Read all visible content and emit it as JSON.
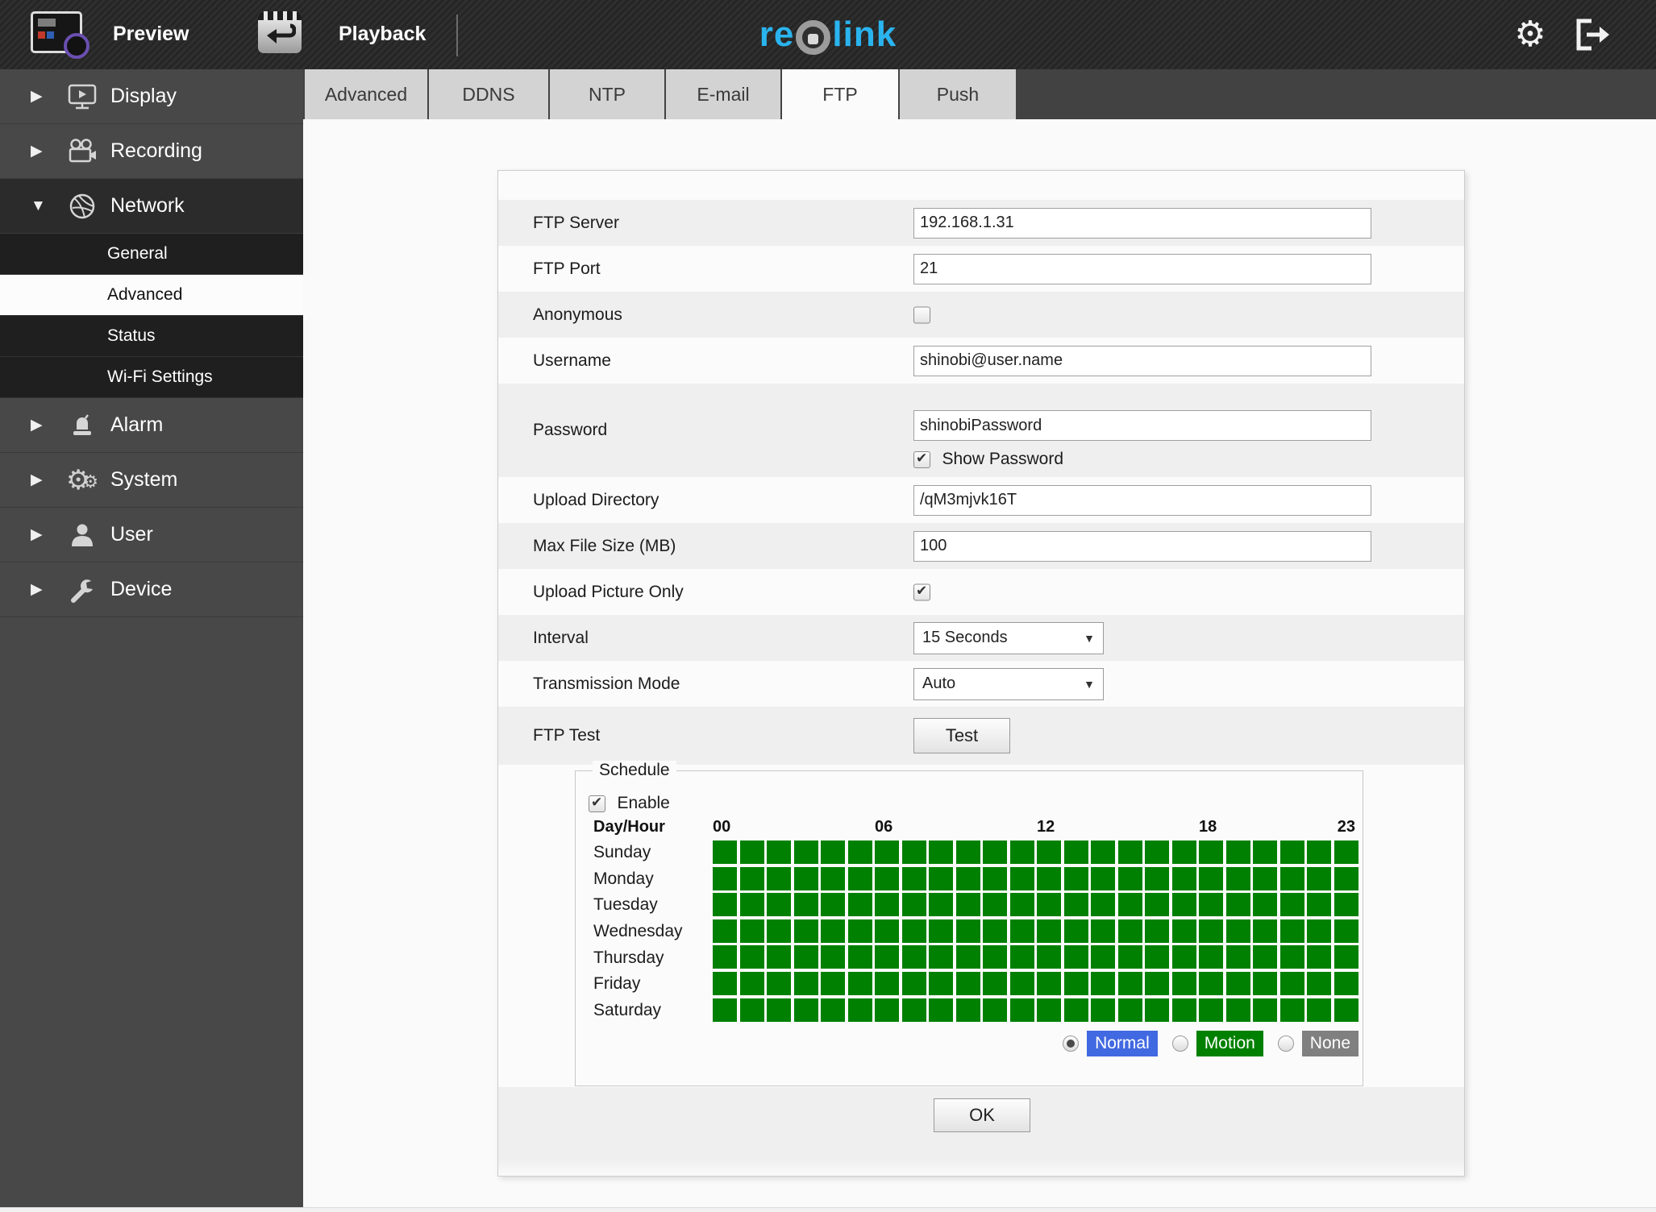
{
  "header": {
    "preview": "Preview",
    "playback": "Playback",
    "logo_part1": "re",
    "logo_part2": "link"
  },
  "glyphs": {
    "collapsed": "▶",
    "expanded": "▼",
    "dropdown": "▼",
    "gear": "⚙",
    "check": "✔"
  },
  "sidebar": {
    "display": "Display",
    "recording": "Recording",
    "network": "Network",
    "general": "General",
    "advanced": "Advanced",
    "status": "Status",
    "wifi": "Wi-Fi Settings",
    "alarm": "Alarm",
    "system": "System",
    "user": "User",
    "device": "Device"
  },
  "tabs": {
    "advanced": "Advanced",
    "ddns": "DDNS",
    "ntp": "NTP",
    "email": "E-mail",
    "ftp": "FTP",
    "push": "Push",
    "active_tab": "FTP"
  },
  "form": {
    "ftp_server": {
      "label": "FTP Server",
      "value": "192.168.1.31"
    },
    "ftp_port": {
      "label": "FTP Port",
      "value": "21"
    },
    "anonymous": {
      "label": "Anonymous",
      "checked": false,
      "glyph": ""
    },
    "username": {
      "label": "Username",
      "value": "shinobi@user.name"
    },
    "password": {
      "label": "Password",
      "value": "shinobiPassword",
      "show_password_label": "Show Password",
      "show_password_glyph": "✔"
    },
    "upload_directory": {
      "label": "Upload Directory",
      "value": "/qM3mjvk16T"
    },
    "max_file_size": {
      "label": "Max File Size (MB)",
      "value": "100"
    },
    "upload_picture_only": {
      "label": "Upload Picture Only",
      "checked": true,
      "glyph": "✔"
    },
    "interval": {
      "label": "Interval",
      "value": "15 Seconds"
    },
    "transmission_mode": {
      "label": "Transmission Mode",
      "value": "Auto"
    },
    "ftp_test": {
      "label": "FTP Test",
      "button_label": "Test"
    },
    "ok_button_label": "OK"
  },
  "schedule": {
    "legend": "Schedule",
    "enable_label": "Enable",
    "enable_glyph": "✔",
    "day_hour_label": "Day/Hour",
    "hour_labels": [
      "00",
      "06",
      "12",
      "18",
      "23"
    ],
    "days": [
      "Sunday",
      "Monday",
      "Tuesday",
      "Wednesday",
      "Thursday",
      "Friday",
      "Saturday"
    ],
    "hours_per_day": 24,
    "all_cells_state": "normal",
    "colors": {
      "normal": "#008000",
      "motion": "#008000",
      "none": "#808080",
      "normal_btn": "#4169e1"
    },
    "modes": [
      {
        "label": "Normal",
        "selected": true,
        "color": "#4169e1"
      },
      {
        "label": "Motion",
        "selected": false,
        "color": "#008000"
      },
      {
        "label": "None",
        "selected": false,
        "color": "#808080"
      }
    ]
  }
}
